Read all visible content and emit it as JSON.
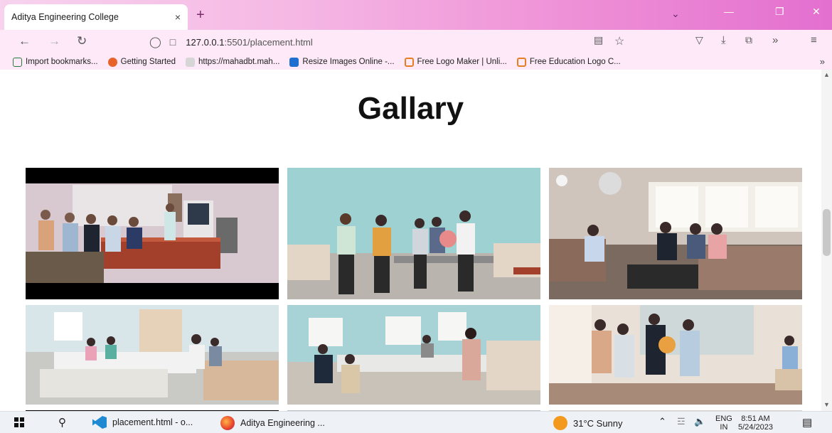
{
  "browser": {
    "tab_title": "Aditya Engineering College",
    "tab_close": "×",
    "new_tab": "+",
    "url_host": "127.0.0.1",
    "url_rest": ":5501/placement.html",
    "bookmarks": [
      {
        "label": "Import bookmarks...",
        "color": "#2a7a3a"
      },
      {
        "label": "Getting Started",
        "color": "#e8622b"
      },
      {
        "label": "https://mahadbt.mah...",
        "color": "#c9c9c9"
      },
      {
        "label": "Resize Images Online -...",
        "color": "#1f6fd1"
      },
      {
        "label": "Free Logo Maker | Unli...",
        "color": "#e67e22"
      },
      {
        "label": "Free Education Logo C...",
        "color": "#e67e22"
      }
    ]
  },
  "page": {
    "heading": "Gallary"
  },
  "gallery": {
    "photos": [
      {
        "name": "gallery-photo-1"
      },
      {
        "name": "gallery-photo-2"
      },
      {
        "name": "gallery-photo-3"
      },
      {
        "name": "gallery-photo-4"
      },
      {
        "name": "gallery-photo-5"
      },
      {
        "name": "gallery-photo-6"
      },
      {
        "name": "gallery-photo-7"
      },
      {
        "name": "gallery-photo-8"
      },
      {
        "name": "gallery-photo-9"
      }
    ]
  },
  "taskbar": {
    "vscode_label": "placement.html - o...",
    "firefox_label": "Aditya Engineering ...",
    "weather": "31°C  Sunny",
    "lang_top": "ENG",
    "lang_bottom": "IN",
    "time": "8:51 AM",
    "date": "5/24/2023"
  }
}
